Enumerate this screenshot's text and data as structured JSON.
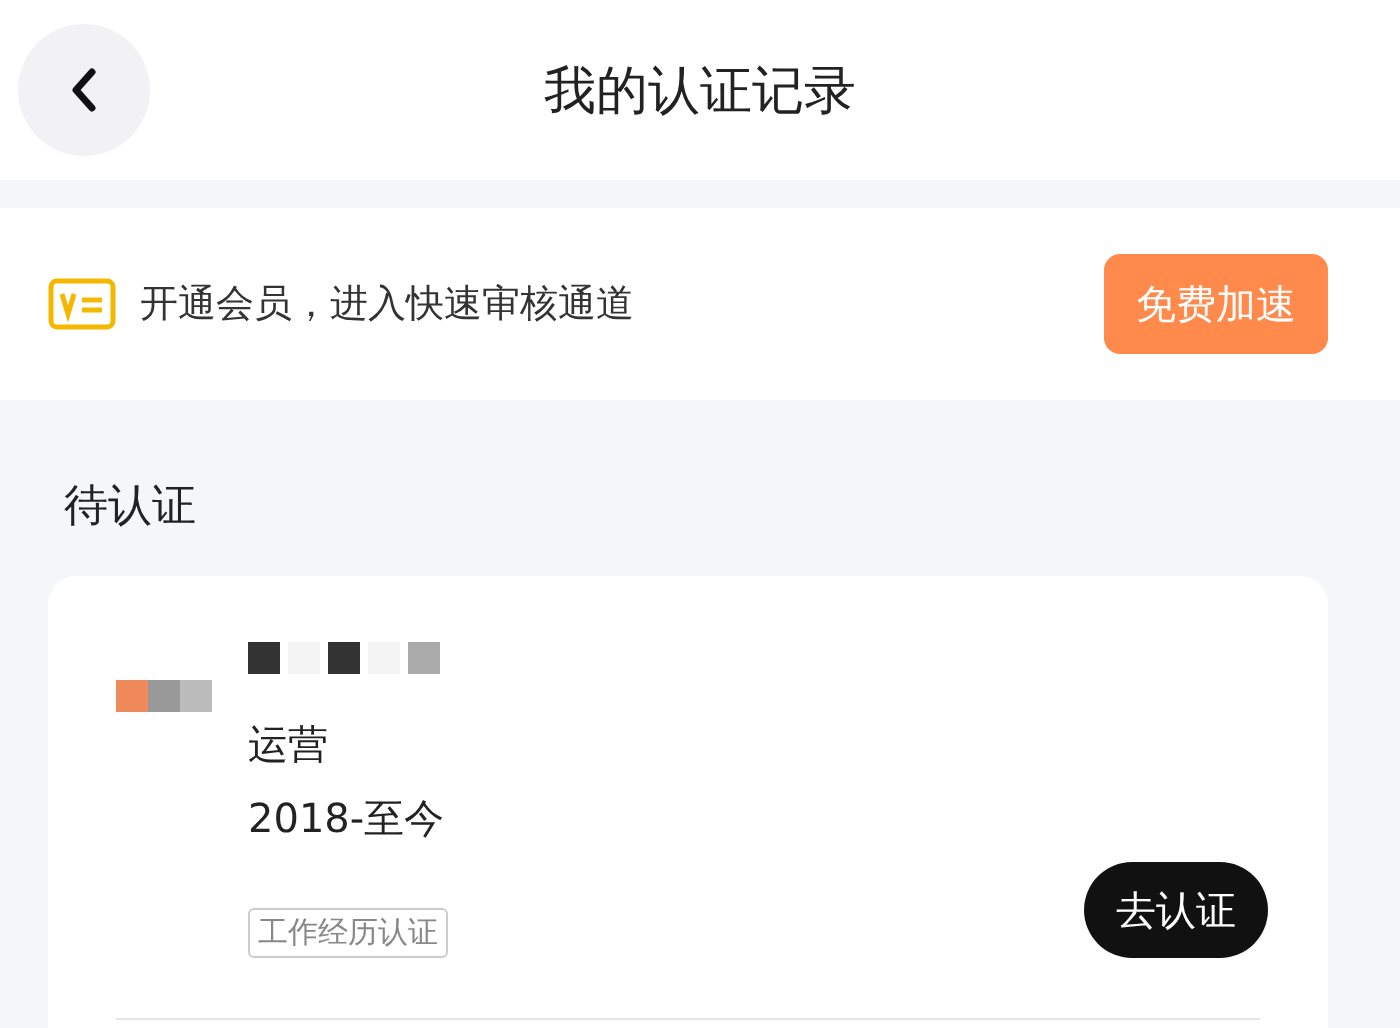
{
  "header": {
    "title": "我的认证记录"
  },
  "banner": {
    "text": "开通会员，进入快速审核通道",
    "button": "免费加速"
  },
  "section": {
    "title": "待认证"
  },
  "records": [
    {
      "position": "运营",
      "period": "2018-至今",
      "tag": "工作经历认证",
      "button": "去认证"
    }
  ]
}
